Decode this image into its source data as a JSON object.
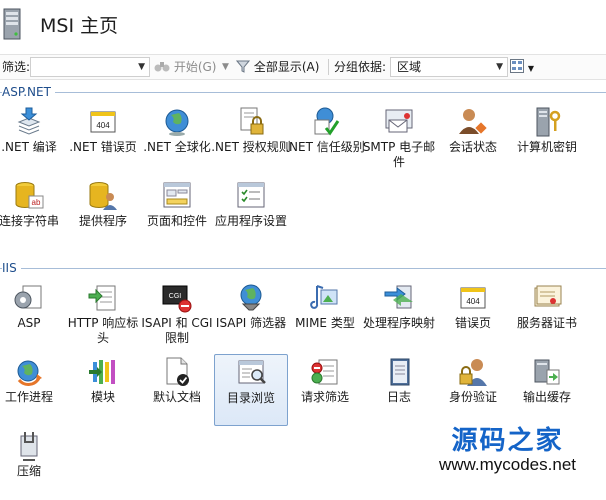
{
  "header": {
    "title": "MSI 主页",
    "icon": "server-icon"
  },
  "toolbar": {
    "filter_label": "筛选:",
    "filter_value": "",
    "start_label": "开始(G)",
    "show_all_label": "全部显示(A)",
    "group_by_label": "分组依据:",
    "group_by_value": "区域",
    "view_icon": "view-mode-icon"
  },
  "groups": [
    {
      "title": "ASP.NET",
      "items": [
        {
          "label": ".NET 编译",
          "icon": "net-compile-icon"
        },
        {
          "label": ".NET 错误页",
          "icon": "error-404-icon"
        },
        {
          "label": ".NET 全球化",
          "icon": "globe-icon"
        },
        {
          "label": ".NET 授权规则",
          "icon": "lock-rules-icon"
        },
        {
          "label": ".NET 信任级别",
          "icon": "trust-check-icon"
        },
        {
          "label": "SMTP 电子邮件",
          "icon": "email-icon"
        },
        {
          "label": "会话状态",
          "icon": "session-users-icon"
        },
        {
          "label": "计算机密钥",
          "icon": "machine-key-icon"
        },
        {
          "label": "连接字符串",
          "icon": "database-ab-icon"
        },
        {
          "label": "提供程序",
          "icon": "provider-users-icon"
        },
        {
          "label": "页面和控件",
          "icon": "page-controls-icon"
        },
        {
          "label": "应用程序设置",
          "icon": "app-settings-icon"
        }
      ]
    },
    {
      "title": "IIS",
      "items": [
        {
          "label": "ASP",
          "icon": "asp-icon"
        },
        {
          "label": "HTTP 响应标头",
          "icon": "http-headers-icon"
        },
        {
          "label": "ISAPI 和 CGI 限制",
          "icon": "cgi-icon"
        },
        {
          "label": "ISAPI 筛选器",
          "icon": "isapi-filter-icon"
        },
        {
          "label": "MIME 类型",
          "icon": "mime-icon"
        },
        {
          "label": "处理程序映射",
          "icon": "handler-map-icon"
        },
        {
          "label": "错误页",
          "icon": "error-404-icon"
        },
        {
          "label": "服务器证书",
          "icon": "certificate-icon"
        },
        {
          "label": "工作进程",
          "icon": "worker-process-icon"
        },
        {
          "label": "模块",
          "icon": "modules-icon"
        },
        {
          "label": "默认文档",
          "icon": "default-doc-icon"
        },
        {
          "label": "目录浏览",
          "icon": "dir-browse-icon",
          "selected": true
        },
        {
          "label": "请求筛选",
          "icon": "request-filter-icon"
        },
        {
          "label": "日志",
          "icon": "logging-icon"
        },
        {
          "label": "身份验证",
          "icon": "auth-icon"
        },
        {
          "label": "输出缓存",
          "icon": "output-cache-icon"
        },
        {
          "label": "压缩",
          "icon": "compress-icon"
        }
      ]
    }
  ],
  "watermark": {
    "line1": "源码之家",
    "line2": "www.mycodes.net"
  },
  "colors": {
    "accent": "#1f4e8c",
    "group_line": "#a7bdd8",
    "watermark": "#1464c8"
  }
}
